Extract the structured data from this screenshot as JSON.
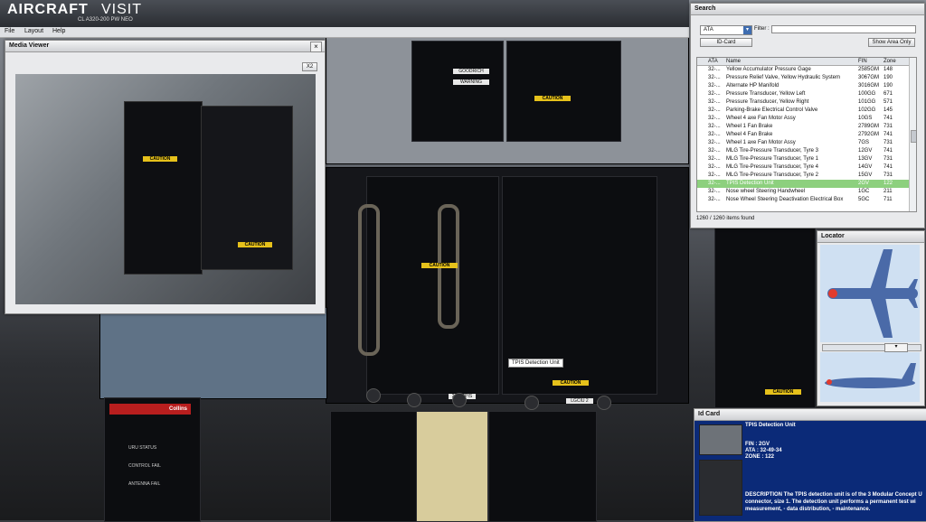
{
  "app": {
    "logo_part1": "AIRCRAFT",
    "logo_part2": "VISIT",
    "subtitle": "CL A320-200 PW NEO",
    "menu": [
      "File",
      "Layout",
      "Help"
    ]
  },
  "media_viewer": {
    "title": "Media Viewer",
    "x2_label": "X2",
    "close": "×"
  },
  "search": {
    "title": "Search",
    "dropdown_value": "ATA",
    "filter_label": "Filter :",
    "filter_value": "",
    "id_card_button": "ID-Card",
    "show_area_button": "Show Area Only",
    "columns": [
      "ATA",
      "Name",
      "FIN",
      "Zone"
    ],
    "rows": [
      {
        "ata": "32-...",
        "name": "Yellow Accumulator Pressure Gage",
        "fin": "2585GM",
        "zone": "148"
      },
      {
        "ata": "32-...",
        "name": "Pressure Relief Valve, Yellow Hydraulic System",
        "fin": "3067GM",
        "zone": "190"
      },
      {
        "ata": "32-...",
        "name": "Alternate HP Manifold",
        "fin": "3016GM",
        "zone": "190"
      },
      {
        "ata": "32-...",
        "name": "Pressure Transducer, Yellow Left",
        "fin": "100GG",
        "zone": "671"
      },
      {
        "ata": "32-...",
        "name": "Pressure Transducer, Yellow Right",
        "fin": "101GG",
        "zone": "571"
      },
      {
        "ata": "32-...",
        "name": "Parking-Brake Electrical Control Valve",
        "fin": "102GG",
        "zone": "145"
      },
      {
        "ata": "32-...",
        "name": "Wheel 4 axe Fan Motor Assy",
        "fin": "10GS",
        "zone": "741"
      },
      {
        "ata": "32-...",
        "name": "Wheel 1 Fan Brake",
        "fin": "2789GM",
        "zone": "731"
      },
      {
        "ata": "32-...",
        "name": "Wheel 4 Fan Brake",
        "fin": "2792GM",
        "zone": "741"
      },
      {
        "ata": "32-...",
        "name": "Wheel 1 axe Fan Motor Assy",
        "fin": "7GS",
        "zone": "731"
      },
      {
        "ata": "32-...",
        "name": "MLG Tire-Pressure Transducer, Tyre 3",
        "fin": "12GV",
        "zone": "741"
      },
      {
        "ata": "32-...",
        "name": "MLG Tire-Pressure Transducer, Tyre 1",
        "fin": "13GV",
        "zone": "731"
      },
      {
        "ata": "32-...",
        "name": "MLG Tire-Pressure Transducer, Tyre 4",
        "fin": "14GV",
        "zone": "741"
      },
      {
        "ata": "32-...",
        "name": "MLG Tire-Pressure Transducer, Tyre 2",
        "fin": "15GV",
        "zone": "731"
      },
      {
        "ata": "32-...",
        "name": "TPIS Detection Unit",
        "fin": "2GV",
        "zone": "122"
      },
      {
        "ata": "32-...",
        "name": "Nose wheel Steering Handwheel",
        "fin": "1GC",
        "zone": "211"
      },
      {
        "ata": "32-...",
        "name": "Nose Wheel Steering Deactivation Electrical Box",
        "fin": "5GC",
        "zone": "711"
      }
    ],
    "selected_index": 14,
    "status": "1260 / 1260 items found"
  },
  "locator": {
    "title": "Locator"
  },
  "tooltip": {
    "text": "TPIS Detection Unit"
  },
  "id_card": {
    "title": "Id Card",
    "name": "TPIS Detection Unit",
    "fin": "FIN : 2GV",
    "ata": "ATA : 32-49-34",
    "zone": "ZONE : 122",
    "description": "DESCRIPTION The TPIS detection unit is of the 3 Modular Concept U",
    "description2": "connector, size 1. The detection unit performs a permanent test wi",
    "description3": "measurement, - data distribution, - maintenance."
  },
  "scene_labels": {
    "caution": "CAUTION",
    "warning": "WARNING",
    "goodrich": "GOODRICH",
    "collins": "Collins",
    "uru_status": "URU STATUS",
    "control_fail": "CONTROL FAIL",
    "antenna_fail": "ANTENNA FAIL",
    "tpis_tag": "2GV TPIS",
    "lgciu_tag": "LGCIU 2"
  },
  "colors": {
    "selection": "#8dd07e",
    "idcard_bg": "#0b2a78",
    "caution_yellow": "#e6c11b",
    "locator_blue": "#cfe0f2",
    "aircraft": "#4a6aa8"
  }
}
